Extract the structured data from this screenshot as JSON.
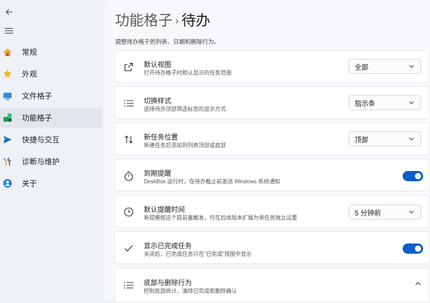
{
  "sidebar": {
    "items": [
      {
        "label": "常规",
        "icon": "home-icon",
        "active": false
      },
      {
        "label": "外观",
        "icon": "star-icon",
        "active": false
      },
      {
        "label": "文件格子",
        "icon": "monitor-icon",
        "active": false
      },
      {
        "label": "功能格子",
        "icon": "blocks-icon",
        "active": true
      },
      {
        "label": "快捷与交互",
        "icon": "send-icon",
        "active": false
      },
      {
        "label": "诊断与维护",
        "icon": "tools-icon",
        "active": false
      },
      {
        "label": "关于",
        "icon": "info-person-icon",
        "active": false
      }
    ]
  },
  "header": {
    "parent": "功能格子",
    "separator": "›",
    "current": "待办",
    "description": "调整待办格子的列表、日期和删除行为。"
  },
  "settings": [
    {
      "title": "默认视图",
      "subtitle": "打开待办格子时默认显示的任务范围",
      "icon": "open-external-icon",
      "control": "dropdown",
      "value": "全部"
    },
    {
      "title": "切换样式",
      "subtitle": "选择待办顶部筛选标签的显示方式",
      "icon": "list-icon",
      "control": "dropdown",
      "value": "指示条"
    },
    {
      "title": "新任务位置",
      "subtitle": "新建任务后添加到列表顶部或底部",
      "icon": "sort-arrows-icon",
      "control": "dropdown",
      "value": "顶部"
    },
    {
      "title": "到期提醒",
      "subtitle": "DeskBox 运行时，在待办截止前发送 Windows 系统通知",
      "icon": "timer-icon",
      "control": "toggle",
      "on": true
    },
    {
      "title": "默认提醒时间",
      "subtitle": "新提醒按这个提前量触发，可在后续版本扩展为单任务独立设置",
      "icon": "clock-icon",
      "control": "dropdown",
      "value": "5 分钟前"
    },
    {
      "title": "显示已完成任务",
      "subtitle": "关闭后，已完成任务只在\"已完成\"视图中显示",
      "icon": "check-icon",
      "control": "toggle",
      "on": true
    },
    {
      "title": "底部与删除行为",
      "subtitle": "控制底部统计、清除已完成和删除确认",
      "icon": "list-icon",
      "control": "expander",
      "expanded": true
    }
  ],
  "colors": {
    "accent": "#0f5fc4",
    "background": "#eef1f6"
  }
}
